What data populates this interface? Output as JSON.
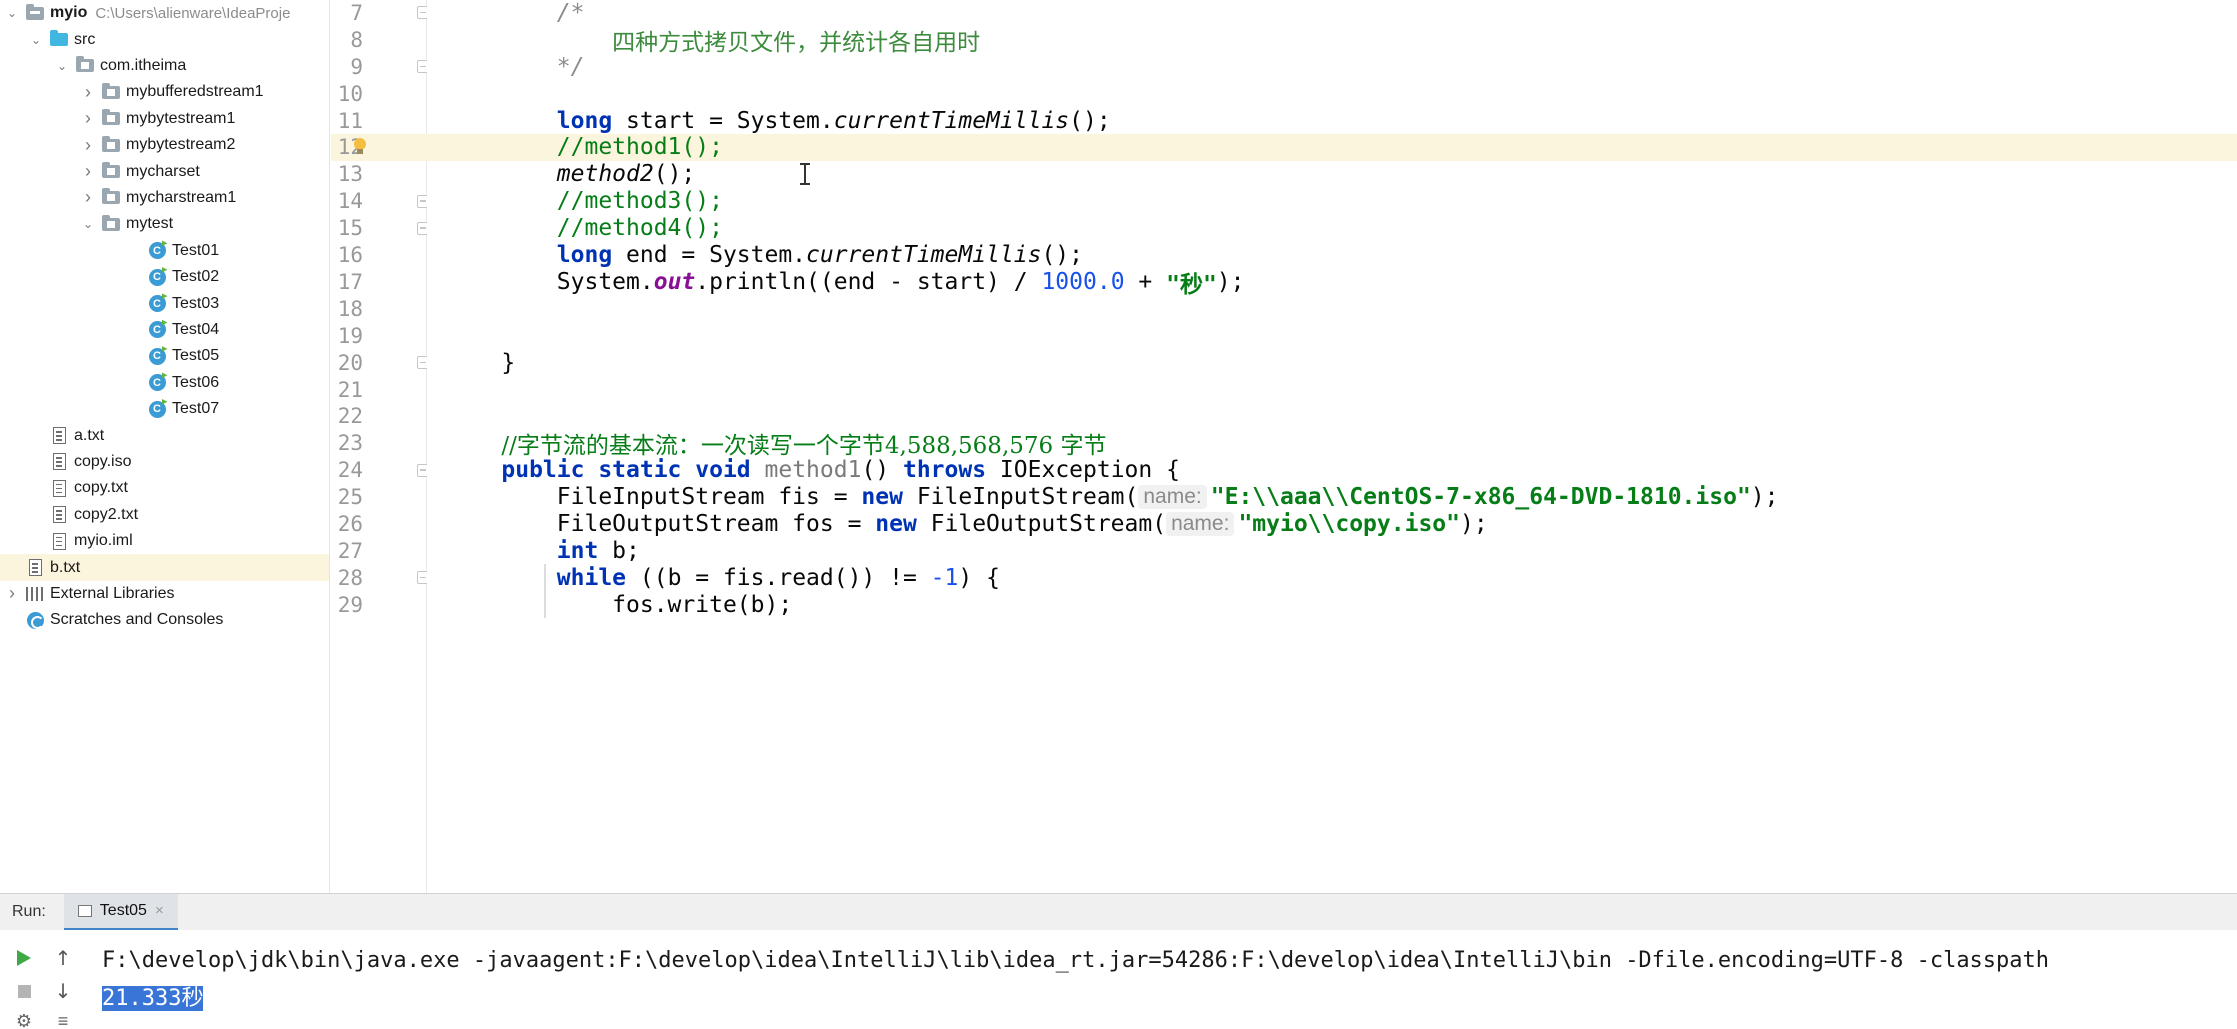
{
  "project_tree": {
    "rows": [
      {
        "label": "myio",
        "path": "C:\\Users\\alienware\\IdeaProje",
        "arrow": "down",
        "icon": "project-folder-icon",
        "depth": 0
      },
      {
        "label": "src",
        "arrow": "down",
        "icon": "source-folder-icon",
        "depth": 1
      },
      {
        "label": "com.itheima",
        "arrow": "down",
        "icon": "package-folder-icon",
        "depth": 2
      },
      {
        "label": "mybufferedstream1",
        "arrow": "right",
        "icon": "package-folder-icon",
        "depth": 3
      },
      {
        "label": "mybytestream1",
        "arrow": "right",
        "icon": "package-folder-icon",
        "depth": 3
      },
      {
        "label": "mybytestream2",
        "arrow": "right",
        "icon": "package-folder-icon",
        "depth": 3
      },
      {
        "label": "mycharset",
        "arrow": "right",
        "icon": "package-folder-icon",
        "depth": 3
      },
      {
        "label": "mycharstream1",
        "arrow": "right",
        "icon": "package-folder-icon",
        "depth": 3
      },
      {
        "label": "mytest",
        "arrow": "down",
        "icon": "package-folder-icon",
        "depth": 3
      },
      {
        "label": "Test01",
        "arrow": "none",
        "icon": "java-class-icon",
        "depth": 4
      },
      {
        "label": "Test02",
        "arrow": "none",
        "icon": "java-class-icon",
        "depth": 4
      },
      {
        "label": "Test03",
        "arrow": "none",
        "icon": "java-class-icon",
        "depth": 4
      },
      {
        "label": "Test04",
        "arrow": "none",
        "icon": "java-class-icon",
        "depth": 4
      },
      {
        "label": "Test05",
        "arrow": "none",
        "icon": "java-class-icon",
        "depth": 4
      },
      {
        "label": "Test06",
        "arrow": "none",
        "icon": "java-class-icon",
        "depth": 4
      },
      {
        "label": "Test07",
        "arrow": "none",
        "icon": "java-class-icon",
        "depth": 4
      },
      {
        "label": "a.txt",
        "arrow": "none",
        "icon": "text-file-icon",
        "depth": 1
      },
      {
        "label": "copy.iso",
        "arrow": "none",
        "icon": "text-file-icon",
        "depth": 1
      },
      {
        "label": "copy.txt",
        "arrow": "none",
        "icon": "text-file-icon",
        "depth": 1
      },
      {
        "label": "copy2.txt",
        "arrow": "none",
        "icon": "text-file-icon",
        "depth": 1
      },
      {
        "label": "myio.iml",
        "arrow": "none",
        "icon": "text-file-icon",
        "depth": 1
      },
      {
        "label": "b.txt",
        "arrow": "none",
        "icon": "text-file-icon",
        "depth": 0,
        "selected": true
      },
      {
        "label": "External Libraries",
        "arrow": "right",
        "icon": "library-icon",
        "depth": 0
      },
      {
        "label": "Scratches and Consoles",
        "arrow": "none",
        "icon": "scratches-icon",
        "depth": 0
      }
    ]
  },
  "editor": {
    "highlighted_line": 12,
    "lines": [
      {
        "n": "7",
        "fold": true,
        "tokens": [
          {
            "t": "        "
          },
          {
            "t": "/*",
            "c": "blockc"
          }
        ]
      },
      {
        "n": "8",
        "tokens": [
          {
            "t": "            "
          },
          {
            "t": "四种方式拷贝文件，并统计各自用时",
            "c": "blockc cn"
          }
        ]
      },
      {
        "n": "9",
        "fold": true,
        "tokens": [
          {
            "t": "        "
          },
          {
            "t": "*/",
            "c": "blockc"
          }
        ]
      },
      {
        "n": "10",
        "tokens": []
      },
      {
        "n": "11",
        "tokens": [
          {
            "t": "        "
          },
          {
            "t": "long",
            "c": "kw"
          },
          {
            "t": " start = System."
          },
          {
            "t": "currentTimeMillis",
            "c": "it"
          },
          {
            "t": "();"
          }
        ]
      },
      {
        "n": "12",
        "tokens": [
          {
            "t": "        "
          },
          {
            "t": "//method1();",
            "c": "com"
          }
        ]
      },
      {
        "n": "13",
        "tokens": [
          {
            "t": "        "
          },
          {
            "t": "method2",
            "c": "it"
          },
          {
            "t": "();"
          }
        ]
      },
      {
        "n": "14",
        "fold": true,
        "tokens": [
          {
            "t": "        "
          },
          {
            "t": "//method3();",
            "c": "com"
          }
        ]
      },
      {
        "n": "15",
        "fold": true,
        "tokens": [
          {
            "t": "        "
          },
          {
            "t": "//method4();",
            "c": "com"
          }
        ]
      },
      {
        "n": "16",
        "tokens": [
          {
            "t": "        "
          },
          {
            "t": "long",
            "c": "kw"
          },
          {
            "t": " end = System."
          },
          {
            "t": "currentTimeMillis",
            "c": "it"
          },
          {
            "t": "();"
          }
        ]
      },
      {
        "n": "17",
        "tokens": [
          {
            "t": "        System."
          },
          {
            "t": "out",
            "c": "field"
          },
          {
            "t": ".println((end - start) / "
          },
          {
            "t": "1000.0",
            "c": "num"
          },
          {
            "t": " + "
          },
          {
            "t": "\"秒\"",
            "c": "str"
          },
          {
            "t": ");"
          }
        ]
      },
      {
        "n": "18",
        "tokens": []
      },
      {
        "n": "19",
        "tokens": []
      },
      {
        "n": "20",
        "fold": true,
        "tokens": [
          {
            "t": "    }"
          }
        ]
      },
      {
        "n": "21",
        "tokens": []
      },
      {
        "n": "22",
        "tokens": []
      },
      {
        "n": "23",
        "tokens": [
          {
            "t": "    "
          },
          {
            "t": "//字节流的基本流：一次读写一个字节4,588,568,576 字节",
            "c": "com cn"
          }
        ]
      },
      {
        "n": "24",
        "fold": true,
        "tokens": [
          {
            "t": "    "
          },
          {
            "t": "public static void",
            "c": "kw"
          },
          {
            "t": " "
          },
          {
            "t": "method1",
            "c": "meth-unused"
          },
          {
            "t": "() "
          },
          {
            "t": "throws",
            "c": "kw"
          },
          {
            "t": " IOException {"
          }
        ]
      },
      {
        "n": "25",
        "tokens": [
          {
            "t": "        FileInputStream fis = "
          },
          {
            "t": "new",
            "c": "kw"
          },
          {
            "t": " FileInputStream("
          },
          {
            "t": "name:",
            "c": "hint"
          },
          {
            "t": "\"E:\\\\aaa\\\\CentOS-7-x86_64-DVD-1810.iso\"",
            "c": "str"
          },
          {
            "t": ");"
          }
        ]
      },
      {
        "n": "26",
        "tokens": [
          {
            "t": "        FileOutputStream fos = "
          },
          {
            "t": "new",
            "c": "kw"
          },
          {
            "t": " FileOutputStream("
          },
          {
            "t": "name:",
            "c": "hint"
          },
          {
            "t": "\"myio\\\\copy.iso\"",
            "c": "str"
          },
          {
            "t": ");"
          }
        ]
      },
      {
        "n": "27",
        "tokens": [
          {
            "t": "        "
          },
          {
            "t": "int",
            "c": "kw"
          },
          {
            "t": " b;"
          }
        ]
      },
      {
        "n": "28",
        "fold": true,
        "tokens": [
          {
            "t": "        "
          },
          {
            "t": "while",
            "c": "kw"
          },
          {
            "t": " ((b = fis.read()) != "
          },
          {
            "t": "-1",
            "c": "num"
          },
          {
            "t": ") {"
          }
        ]
      },
      {
        "n": "29",
        "tokens": [
          {
            "t": "            fos.write(b);"
          }
        ]
      }
    ]
  },
  "run_panel": {
    "label": "Run:",
    "tab_label": "Test05",
    "tab_close": "×",
    "command_line": "F:\\develop\\jdk\\bin\\java.exe -javaagent:F:\\develop\\idea\\IntelliJ\\lib\\idea_rt.jar=54286:F:\\develop\\idea\\IntelliJ\\bin -Dfile.encoding=UTF-8 -classpath",
    "output": "21.333秒"
  },
  "colors": {
    "keyword": "#0033b3",
    "comment": "#067d17",
    "string": "#067d17",
    "number": "#1750eb",
    "current_line": "#fcf5dd",
    "selection": "#3875d7"
  }
}
